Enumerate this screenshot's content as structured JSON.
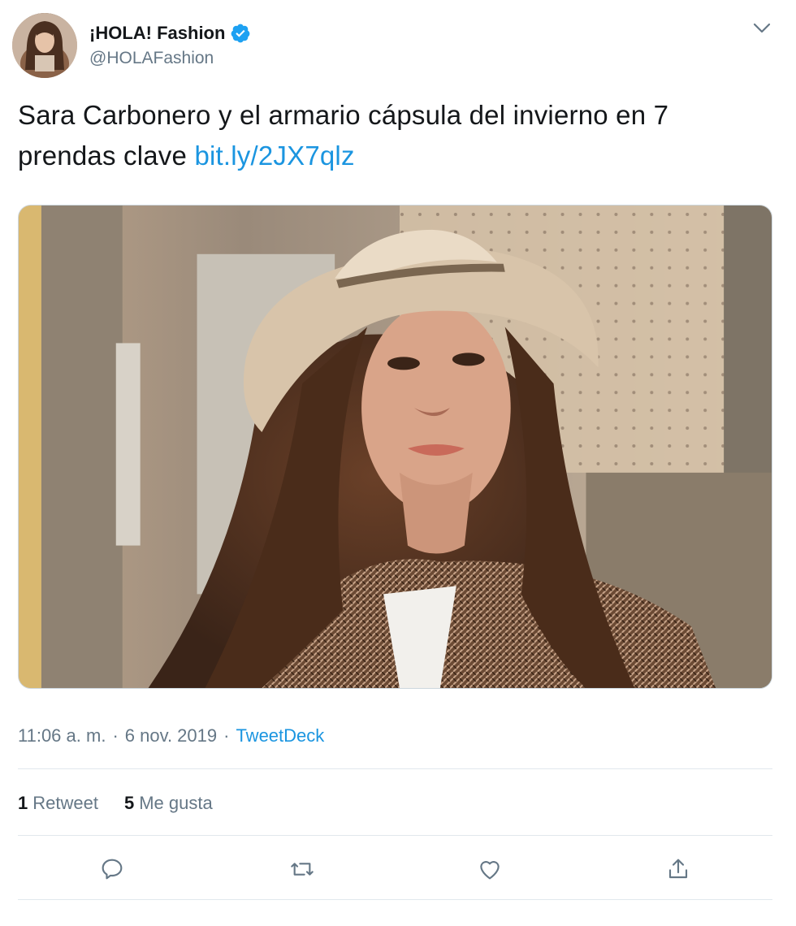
{
  "author": {
    "display_name": "¡HOLA! Fashion",
    "handle": "@HOLAFashion",
    "verified": true,
    "avatar_icon": "profile-photo"
  },
  "tweet": {
    "text": "Sara Carbonero y el armario cápsula del invierno en 7 prendas clave ",
    "link": "bit.ly/2JX7qlz",
    "media_description": "photo"
  },
  "meta": {
    "time": "11:06 a. m.",
    "separator": "·",
    "date": "6 nov. 2019",
    "source": "TweetDeck"
  },
  "stats": {
    "retweets_count": "1",
    "retweets_label": "Retweet",
    "likes_count": "5",
    "likes_label": "Me gusta"
  },
  "actions": [
    {
      "name": "reply",
      "icon": "reply-icon"
    },
    {
      "name": "retweet",
      "icon": "retweet-icon"
    },
    {
      "name": "like",
      "icon": "heart-icon"
    },
    {
      "name": "share",
      "icon": "share-icon"
    }
  ],
  "colors": {
    "link": "#1b95e0",
    "secondary_text": "#657786",
    "primary_text": "#14171a",
    "divider": "#e1e8ed",
    "verified_badge": "#1da1f2"
  }
}
